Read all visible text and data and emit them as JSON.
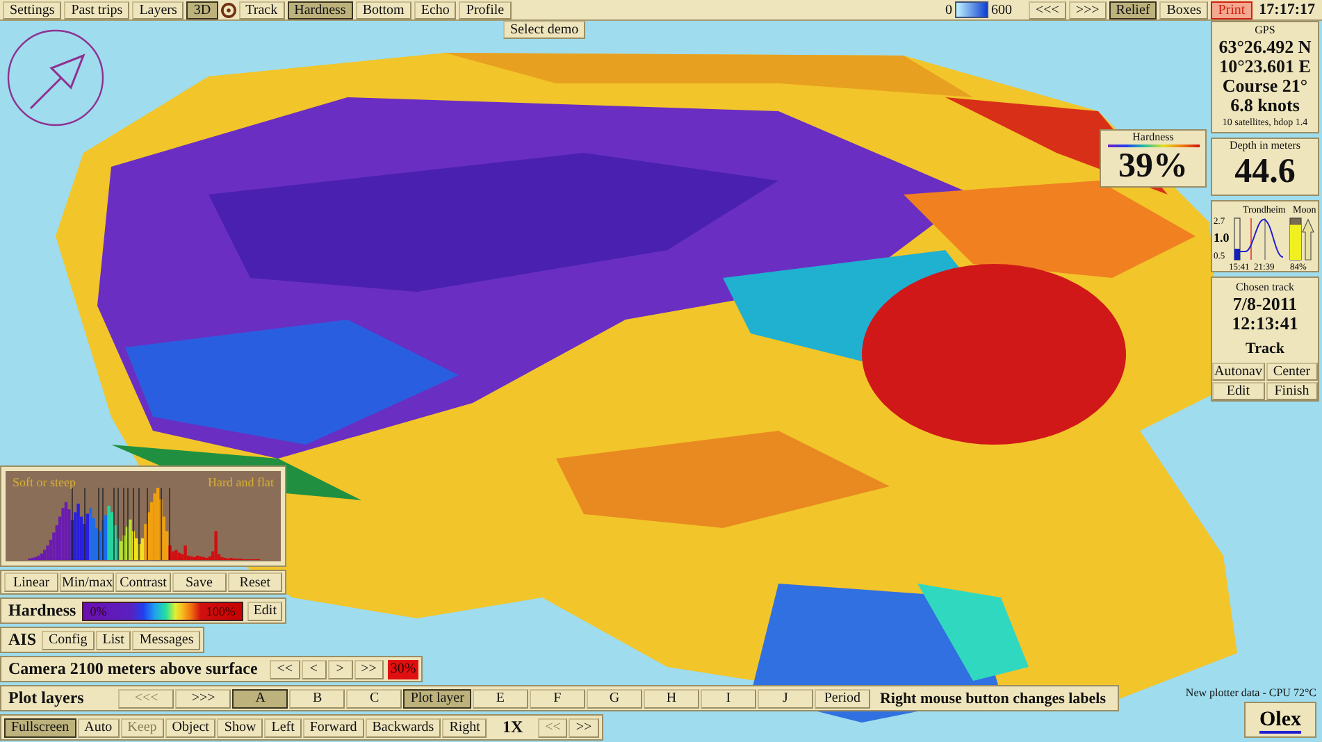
{
  "toolbar": {
    "buttons": [
      {
        "kind": "button",
        "label": "Settings",
        "selected": false
      },
      {
        "kind": "button",
        "label": "Past trips",
        "selected": false
      },
      {
        "kind": "button",
        "label": "Layers",
        "selected": false
      },
      {
        "kind": "button",
        "label": "3D",
        "selected": true
      },
      {
        "kind": "icon"
      },
      {
        "kind": "button",
        "label": "Track",
        "selected": false
      },
      {
        "kind": "button",
        "label": "Hardness",
        "selected": true
      },
      {
        "kind": "button",
        "label": "Bottom",
        "selected": false
      },
      {
        "kind": "button",
        "label": "Echo",
        "selected": false
      },
      {
        "kind": "button",
        "label": "Profile",
        "selected": false
      }
    ],
    "depth_scale": {
      "min": "0",
      "max": "600"
    },
    "right_buttons": [
      {
        "kind": "button",
        "label": "<<<",
        "selected": false
      },
      {
        "kind": "button",
        "label": ">>>",
        "selected": false
      },
      {
        "kind": "button",
        "label": "Relief",
        "selected": true
      },
      {
        "kind": "button",
        "label": "Boxes",
        "selected": false
      },
      {
        "kind": "alert",
        "label": "Print"
      }
    ],
    "clock": "17:17:17"
  },
  "demo_button": "Select demo",
  "gps": {
    "title": "GPS",
    "latitude": "63°26.492 N",
    "longitude": "10°23.601 E",
    "course": "Course 21°",
    "speed": "6.8 knots",
    "info": "10 satellites, hdop 1.4"
  },
  "hardness_box": {
    "title": "Hardness",
    "value": "39%"
  },
  "depth_box": {
    "title": "Depth in meters",
    "value": "44.6"
  },
  "tide": {
    "place": "Trondheim",
    "y_labels": [
      "2.7",
      "1.0",
      "0.5"
    ],
    "times": [
      "15:41",
      "21:39"
    ]
  },
  "moon": {
    "title": "Moon",
    "level": 0.84,
    "reading": "84%"
  },
  "track": {
    "title": "Chosen track",
    "date": "7/8-2011",
    "time": "12:13:41",
    "name": "Track",
    "buttons": [
      "Autonav",
      "Center",
      "Edit",
      "Finish"
    ]
  },
  "histogram": {
    "left_label": "Soft or steep",
    "right_label": "Hard and flat",
    "buttons": [
      "Linear",
      "Min/max",
      "Contrast",
      "Save",
      "Reset"
    ]
  },
  "hardness_scale": {
    "title": "Hardness",
    "min": "0%",
    "max": "100%",
    "button": "Edit"
  },
  "ais": {
    "title": "AIS",
    "buttons": [
      "Config",
      "List",
      "Messages"
    ]
  },
  "camera": {
    "title": "Camera 2100 meters above surface",
    "buttons": [
      "<<",
      "<",
      ">",
      ">>"
    ],
    "zoom": "30%"
  },
  "plot_layers": {
    "title": "Plot layers",
    "buttons": [
      {
        "label": "<<<",
        "selected": false,
        "disabled": true
      },
      {
        "label": ">>>",
        "selected": false,
        "disabled": false
      },
      {
        "label": "A",
        "selected": true,
        "disabled": false
      },
      {
        "label": "B",
        "selected": false,
        "disabled": false
      },
      {
        "label": "C",
        "selected": false,
        "disabled": false
      },
      {
        "label": "Plot layer",
        "selected": true,
        "disabled": false
      },
      {
        "label": "E",
        "selected": false,
        "disabled": false
      },
      {
        "label": "F",
        "selected": false,
        "disabled": false
      },
      {
        "label": "G",
        "selected": false,
        "disabled": false
      },
      {
        "label": "H",
        "selected": false,
        "disabled": false
      },
      {
        "label": "I",
        "selected": false,
        "disabled": false
      },
      {
        "label": "J",
        "selected": false,
        "disabled": false
      },
      {
        "label": "Period",
        "selected": false,
        "disabled": false
      }
    ],
    "hint": "Right mouse button changes labels"
  },
  "view_buttons": [
    {
      "kind": "button",
      "label": "Fullscreen",
      "selected": true,
      "disabled": false
    },
    {
      "kind": "button",
      "label": "Auto",
      "selected": false,
      "disabled": false
    },
    {
      "kind": "button",
      "label": "Keep",
      "selected": false,
      "disabled": true
    },
    {
      "kind": "button",
      "label": "Object",
      "selected": false,
      "disabled": false
    },
    {
      "kind": "button",
      "label": "Show",
      "selected": false,
      "disabled": false
    },
    {
      "kind": "button",
      "label": "Left",
      "selected": false,
      "disabled": false
    },
    {
      "kind": "button",
      "label": "Forward",
      "selected": false,
      "disabled": false
    },
    {
      "kind": "button",
      "label": "Backwards",
      "selected": false,
      "disabled": false
    },
    {
      "kind": "button",
      "label": "Right",
      "selected": false,
      "disabled": false
    },
    {
      "kind": "label",
      "label": "1X"
    },
    {
      "kind": "button",
      "label": "<<",
      "selected": false,
      "disabled": true
    },
    {
      "kind": "button",
      "label": ">>",
      "selected": false,
      "disabled": false
    }
  ],
  "status": "New plotter data - CPU 72°C",
  "logo": "Olex"
}
